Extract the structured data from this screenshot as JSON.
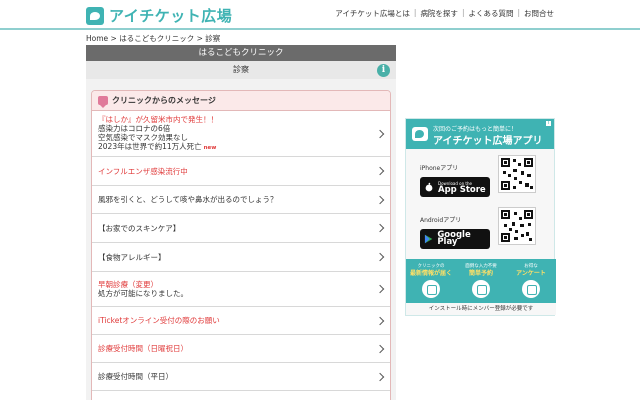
{
  "header": {
    "logo_text": "アイチケット広場",
    "nav": [
      "アイチケット広場とは",
      "病院を探す",
      "よくある質問",
      "お問合せ"
    ]
  },
  "breadcrumb": "Home > はるこどもクリニック > 診察",
  "clinic": {
    "name": "はるこどもクリニック",
    "section": "診察"
  },
  "messages": {
    "title": "クリニックからのメッセージ",
    "items": [
      {
        "lines": [
          "『はしか』が久留米市内で発生！！",
          "感染力はコロナの6倍",
          "空気感染でマスク効果なし",
          "2023年は世界で約11万人死亡"
        ],
        "new": "new"
      },
      {
        "lines": [
          "インフルエンザ感染流行中"
        ]
      },
      {
        "lines": [
          "風邪を引くと、どうして咳や鼻水が出るのでしょう？"
        ]
      },
      {
        "lines": [
          "【お家でのスキンケア】"
        ]
      },
      {
        "lines": [
          "【食物アレルギー】"
        ]
      },
      {
        "lines": [
          "早朝診療（変更）",
          "処方が可能になりました。"
        ]
      },
      {
        "lines": [
          "iTicketオンライン受付の際のお願い"
        ]
      },
      {
        "lines": [
          "診療受付時間（日曜祝日）"
        ]
      },
      {
        "lines": [
          "診療受付時間（平日）"
        ]
      }
    ]
  },
  "ad": {
    "subtitle": "次回のご予約はもっと簡単に！",
    "title": "アイチケット広場アプリ",
    "iphone_label": "iPhoneアプリ",
    "appstore_small": "Download on the",
    "appstore_big": "App Store",
    "android_label": "Androidアプリ",
    "google_small": "",
    "google_big": "Google Play",
    "features": [
      {
        "small": "クリニックの",
        "big": "最新情報が届く"
      },
      {
        "small": "面倒な入力不要",
        "big": "簡単予約"
      },
      {
        "small": "お得な",
        "big": "アンケート"
      }
    ],
    "footer": "インストール時にメンバー登録が必要です"
  }
}
